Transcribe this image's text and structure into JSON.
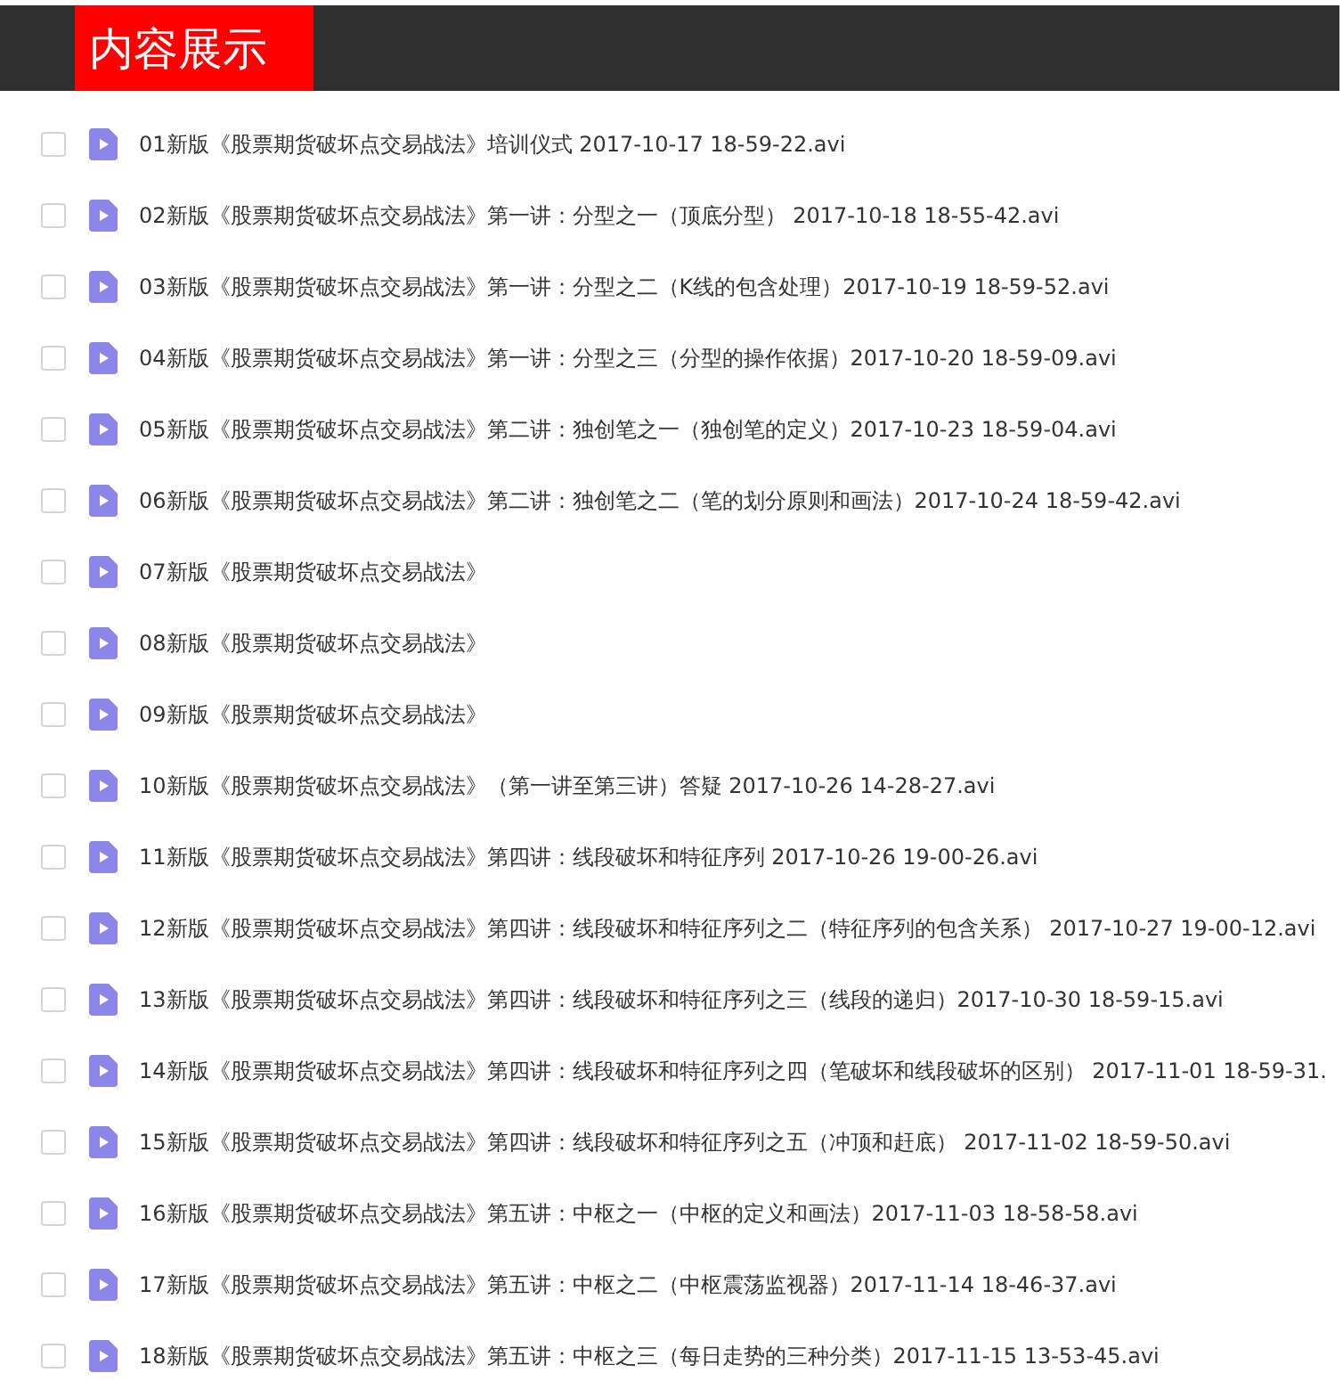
{
  "header": {
    "title": "内容展示"
  },
  "files": [
    {
      "name": "01新版《股票期货破坏点交易战法》培训仪式 2017-10-17 18-59-22.avi",
      "checked": false
    },
    {
      "name": "02新版《股票期货破坏点交易战法》第一讲：分型之一（顶底分型） 2017-10-18 18-55-42.avi",
      "checked": false
    },
    {
      "name": "03新版《股票期货破坏点交易战法》第一讲：分型之二（K线的包含处理）2017-10-19 18-59-52.avi",
      "checked": false
    },
    {
      "name": "04新版《股票期货破坏点交易战法》第一讲：分型之三（分型的操作依据）2017-10-20 18-59-09.avi",
      "checked": false
    },
    {
      "name": "05新版《股票期货破坏点交易战法》第二讲：独创笔之一（独创笔的定义）2017-10-23 18-59-04.avi",
      "checked": false
    },
    {
      "name": "06新版《股票期货破坏点交易战法》第二讲：独创笔之二（笔的划分原则和画法）2017-10-24 18-59-42.avi",
      "checked": false
    },
    {
      "name": "07新版《股票期货破坏点交易战法》",
      "checked": false
    },
    {
      "name": "08新版《股票期货破坏点交易战法》",
      "checked": false
    },
    {
      "name": "09新版《股票期货破坏点交易战法》",
      "checked": false
    },
    {
      "name": "10新版《股票期货破坏点交易战法》（第一讲至第三讲）答疑 2017-10-26 14-28-27.avi",
      "checked": false
    },
    {
      "name": "11新版《股票期货破坏点交易战法》第四讲：线段破坏和特征序列 2017-10-26 19-00-26.avi",
      "checked": false
    },
    {
      "name": "12新版《股票期货破坏点交易战法》第四讲：线段破坏和特征序列之二（特征序列的包含关系） 2017-10-27 19-00-12.avi",
      "checked": false
    },
    {
      "name": "13新版《股票期货破坏点交易战法》第四讲：线段破坏和特征序列之三（线段的递归）2017-10-30 18-59-15.avi",
      "checked": false
    },
    {
      "name": "14新版《股票期货破坏点交易战法》第四讲：线段破坏和特征序列之四（笔破坏和线段破坏的区别） 2017-11-01 18-59-31.",
      "checked": false
    },
    {
      "name": "15新版《股票期货破坏点交易战法》第四讲：线段破坏和特征序列之五（冲顶和赶底） 2017-11-02 18-59-50.avi",
      "checked": false
    },
    {
      "name": "16新版《股票期货破坏点交易战法》第五讲：中枢之一（中枢的定义和画法）2017-11-03 18-58-58.avi",
      "checked": false
    },
    {
      "name": "17新版《股票期货破坏点交易战法》第五讲：中枢之二（中枢震荡监视器）2017-11-14 18-46-37.avi",
      "checked": false
    },
    {
      "name": "18新版《股票期货破坏点交易战法》第五讲：中枢之三（每日走势的三种分类）2017-11-15 13-53-45.avi",
      "checked": false
    }
  ]
}
